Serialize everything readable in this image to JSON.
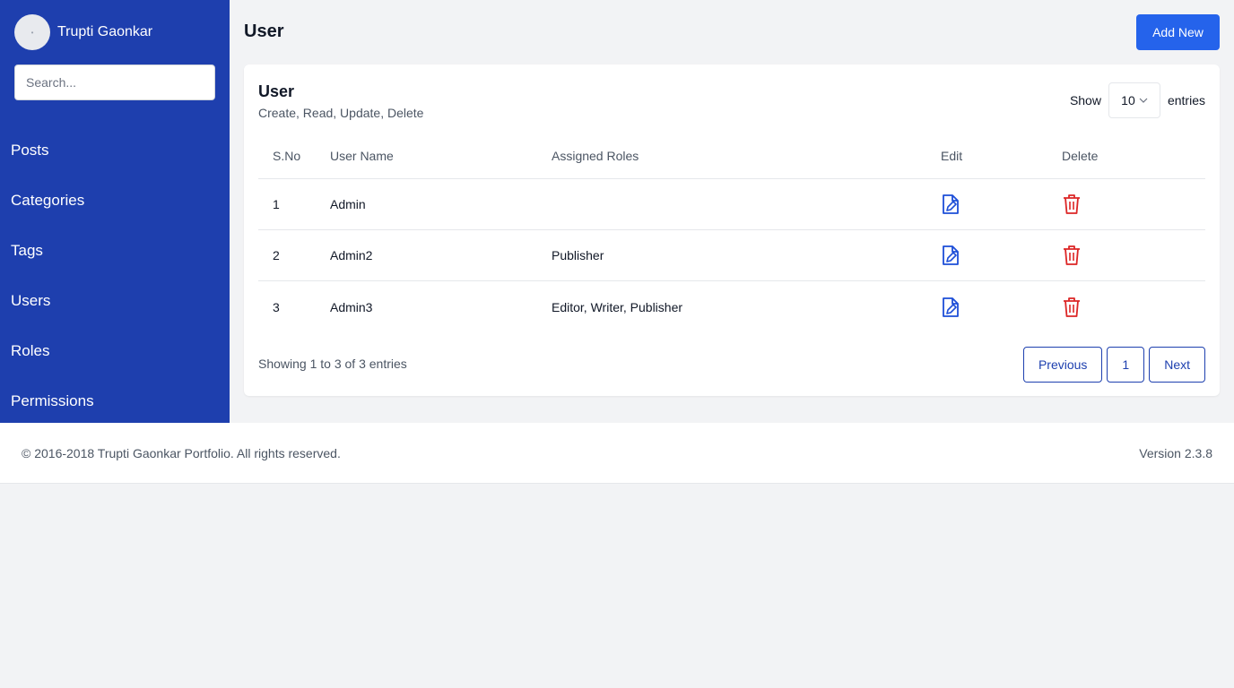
{
  "sidebar": {
    "profile_name": "Trupti Gaonkar",
    "search_placeholder": "Search...",
    "items": [
      {
        "label": "Posts"
      },
      {
        "label": "Categories"
      },
      {
        "label": "Tags"
      },
      {
        "label": "Users"
      },
      {
        "label": "Roles"
      },
      {
        "label": "Permissions"
      }
    ]
  },
  "header": {
    "title": "User",
    "add_button": "Add New"
  },
  "card": {
    "title": "User",
    "subtitle": "Create, Read, Update, Delete",
    "show_label": "Show",
    "entries_value": "10",
    "entries_label": "entries"
  },
  "table": {
    "headers": [
      "S.No",
      "User Name",
      "Assigned Roles",
      "Edit",
      "Delete"
    ],
    "rows": [
      {
        "sno": "1",
        "name": "Admin",
        "roles": ""
      },
      {
        "sno": "2",
        "name": "Admin2",
        "roles": "Publisher"
      },
      {
        "sno": "3",
        "name": "Admin3",
        "roles": "Editor, Writer, Publisher"
      }
    ]
  },
  "pagination": {
    "info": "Showing 1 to 3 of 3 entries",
    "previous": "Previous",
    "page": "1",
    "next": "Next"
  },
  "footer": {
    "copyright": "© 2016-2018 Trupti Gaonkar Portfolio. All rights reserved.",
    "version": "Version 2.3.8"
  },
  "colors": {
    "sidebar": "#1e3fae",
    "primary": "#2563eb",
    "edit_icon": "#1d4ed8",
    "delete_icon": "#dc2626"
  },
  "icons": {
    "edit": "file-edit-icon",
    "delete": "trash-icon"
  }
}
